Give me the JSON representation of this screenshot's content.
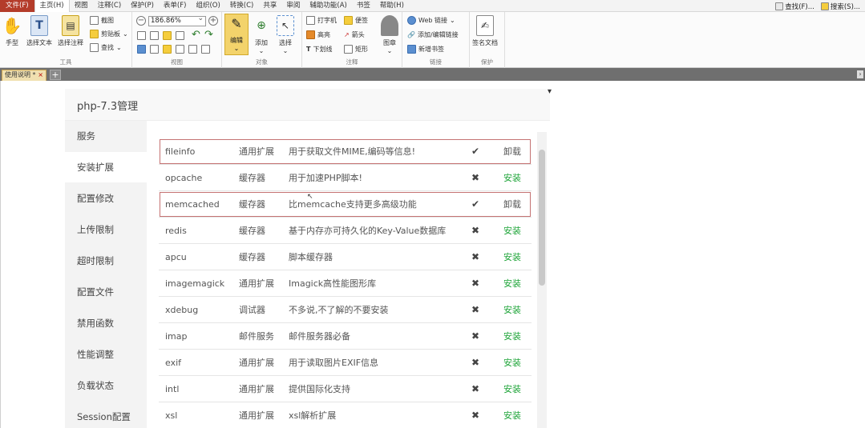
{
  "menubar": {
    "items": [
      "文件(F)",
      "主页(H)",
      "视图",
      "注释(C)",
      "保护(P)",
      "表单(F)",
      "组织(O)",
      "转换(C)",
      "共享",
      "审阅",
      "辅助功能(A)",
      "书签",
      "帮助(H)"
    ],
    "right": {
      "find": "查找(F)...",
      "search": "搜索(S)..."
    }
  },
  "ribbon": {
    "tools": {
      "hand": "手型",
      "select_text": "选择文本",
      "select_annot": "选择注释",
      "snapshot": "截图",
      "clipboard": "剪贴板",
      "find": "查找",
      "label": "工具"
    },
    "view": {
      "zoom": "186.86%",
      "label": "视图"
    },
    "object": {
      "edit": "编辑",
      "add": "添加",
      "select": "选择",
      "label": "对象"
    },
    "annot": {
      "typewriter": "打字机",
      "note": "便签",
      "highlight": "高亮",
      "arrow": "箭头",
      "underline": "下划线",
      "rect": "矩形",
      "stamp": "图章",
      "label": "注释"
    },
    "link": {
      "web": "Web 链接",
      "add_edit": "添加/编辑链接",
      "bookmark": "新增书签",
      "label": "链接"
    },
    "protect": {
      "sign": "签名文档",
      "label": "保护"
    }
  },
  "tabs": {
    "doc": "使用说明 *",
    "close": "×",
    "new": "+"
  },
  "page": {
    "title": "php-7.3管理",
    "nav": [
      "服务",
      "安装扩展",
      "配置修改",
      "上传限制",
      "超时限制",
      "配置文件",
      "禁用函数",
      "性能调整",
      "负载状态",
      "Session配置"
    ],
    "rows": [
      {
        "name": "fileinfo",
        "type": "通用扩展",
        "desc": "用于获取文件MIME,编码等信息!",
        "status": "✔",
        "action": "卸载"
      },
      {
        "name": "opcache",
        "type": "缓存器",
        "desc": "用于加速PHP脚本!",
        "status": "✖",
        "action": "安装"
      },
      {
        "name": "memcached",
        "type": "缓存器",
        "desc": "比memcache支持更多高级功能",
        "status": "✔",
        "action": "卸载"
      },
      {
        "name": "redis",
        "type": "缓存器",
        "desc": "基于内存亦可持久化的Key-Value数据库",
        "status": "✖",
        "action": "安装"
      },
      {
        "name": "apcu",
        "type": "缓存器",
        "desc": "脚本缓存器",
        "status": "✖",
        "action": "安装"
      },
      {
        "name": "imagemagick",
        "type": "通用扩展",
        "desc": "Imagick高性能图形库",
        "status": "✖",
        "action": "安装"
      },
      {
        "name": "xdebug",
        "type": "调试器",
        "desc": "不多说,不了解的不要安装",
        "status": "✖",
        "action": "安装"
      },
      {
        "name": "imap",
        "type": "邮件服务",
        "desc": "邮件服务器必备",
        "status": "✖",
        "action": "安装"
      },
      {
        "name": "exif",
        "type": "通用扩展",
        "desc": "用于读取图片EXIF信息",
        "status": "✖",
        "action": "安装"
      },
      {
        "name": "intl",
        "type": "通用扩展",
        "desc": "提供国际化支持",
        "status": "✖",
        "action": "安装"
      },
      {
        "name": "xsl",
        "type": "通用扩展",
        "desc": "xsl解析扩展",
        "status": "✖",
        "action": "安装"
      }
    ]
  },
  "colors": {
    "file_menu": "#b43c2a",
    "install_link": "#20a53a",
    "highlight_border": "#c57373"
  }
}
